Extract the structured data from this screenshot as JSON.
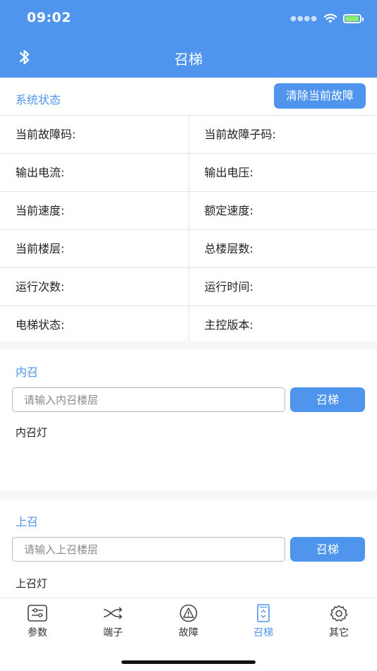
{
  "status_bar": {
    "time": "09:02"
  },
  "header": {
    "title": "召梯",
    "bluetooth_icon": "bluetooth-icon"
  },
  "system_status": {
    "title": "系统状态",
    "clear_button": "清除当前故障",
    "rows": [
      [
        "当前故障码:",
        "当前故障子码:"
      ],
      [
        "输出电流:",
        "输出电压:"
      ],
      [
        "当前速度:",
        "额定速度:"
      ],
      [
        "当前楼层:",
        "总楼层数:"
      ],
      [
        "运行次数:",
        "运行时间:"
      ],
      [
        "电梯状态:",
        "主控版本:"
      ]
    ]
  },
  "inner_call": {
    "title": "内召",
    "placeholder": "请输入内召楼层",
    "button": "召梯",
    "lamp_label": "内召灯"
  },
  "up_call": {
    "title": "上召",
    "placeholder": "请输入上召楼层",
    "button": "召梯",
    "lamp_label": "上召灯"
  },
  "tabs": [
    {
      "label": "参数",
      "icon": "settings-sliders-icon",
      "active": false
    },
    {
      "label": "端子",
      "icon": "shuffle-icon",
      "active": false
    },
    {
      "label": "故障",
      "icon": "warning-icon",
      "active": false
    },
    {
      "label": "召梯",
      "icon": "elevator-icon",
      "active": true
    },
    {
      "label": "其它",
      "icon": "gear-icon",
      "active": false
    }
  ],
  "colors": {
    "accent": "#4f95ee",
    "battery": "#8ef06b"
  }
}
